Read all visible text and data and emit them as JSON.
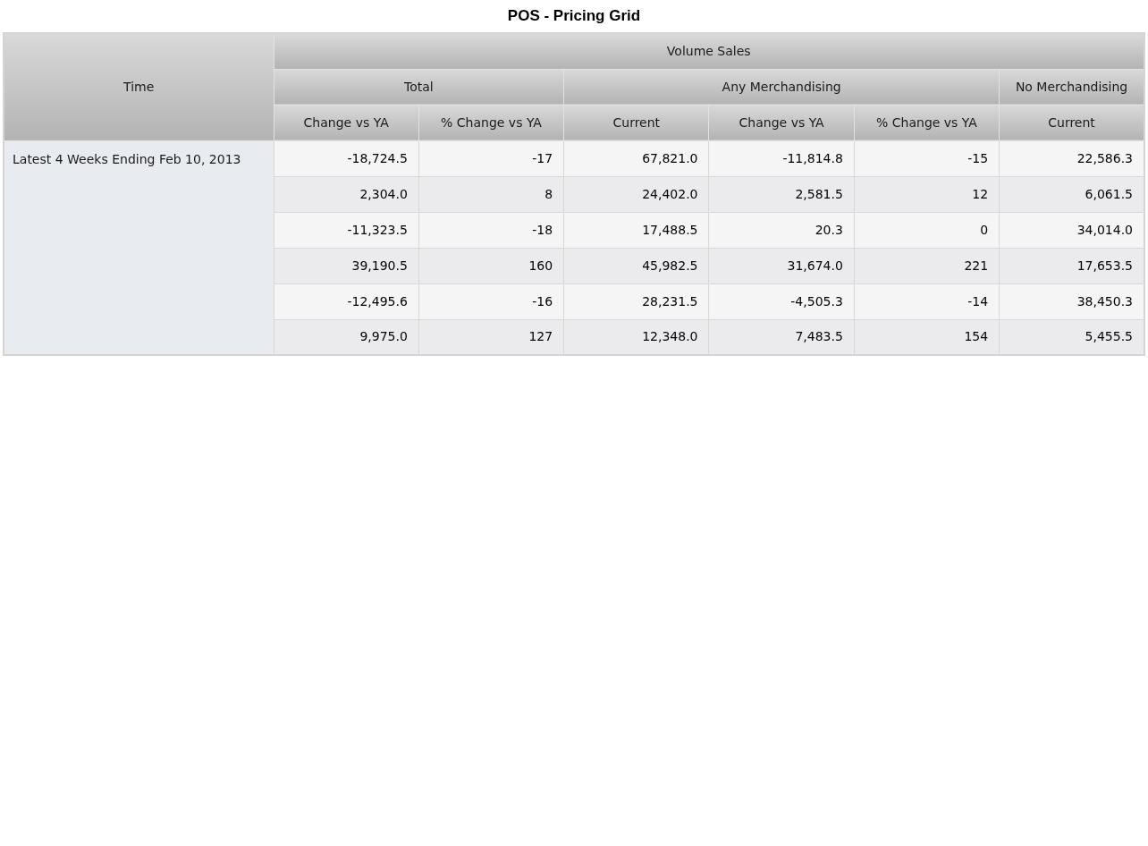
{
  "title": "POS - Pricing Grid",
  "header": {
    "row_label": "Time",
    "measure": "Volume Sales",
    "groups": [
      {
        "label": "Total",
        "columns": [
          "Change vs YA",
          "% Change vs YA"
        ]
      },
      {
        "label": "Any Merchandising",
        "columns": [
          "Current",
          "Change vs YA",
          "% Change vs YA"
        ]
      },
      {
        "label": "No Merchandising",
        "columns": [
          "Current"
        ]
      }
    ]
  },
  "periods": [
    {
      "label": "Latest 4 Weeks Ending Feb 10, 2013",
      "rows": [
        [
          "-18,724.5",
          "-17",
          "67,821.0",
          "-11,814.8",
          "-15",
          "22,586.3"
        ],
        [
          "2,304.0",
          "8",
          "24,402.0",
          "2,581.5",
          "12",
          "6,061.5"
        ],
        [
          "-11,323.5",
          "-18",
          "17,488.5",
          "20.3",
          "0",
          "34,014.0"
        ],
        [
          "39,190.5",
          "160",
          "45,982.5",
          "31,674.0",
          "221",
          "17,653.5"
        ],
        [
          "-12,495.6",
          "-16",
          "28,231.5",
          "-4,505.3",
          "-14",
          "38,450.3"
        ],
        [
          "9,975.0",
          "127",
          "12,348.0",
          "7,483.5",
          "154",
          "5,455.5"
        ]
      ]
    }
  ]
}
